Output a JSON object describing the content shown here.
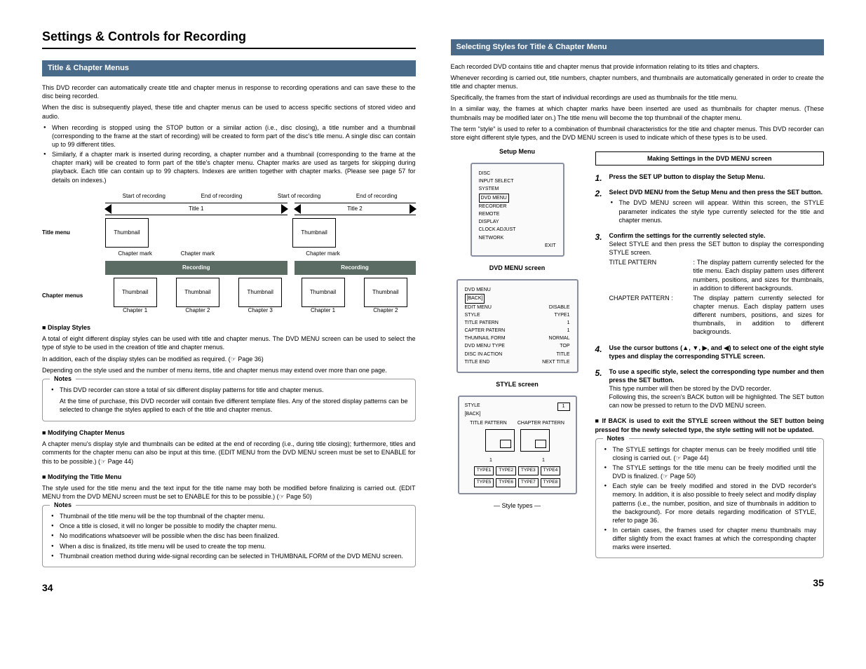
{
  "heading": "Settings & Controls for Recording",
  "left": {
    "section": "Title & Chapter Menus",
    "intro1": "This DVD recorder can automatically create title and chapter menus in response to recording operations and can save these to the disc being recorded.",
    "intro2": "When the disc is subsequently played, these title and chapter menus can be used to access specific sections of stored video and audio.",
    "b1": "When recording is stopped using the STOP button or a similar action (i.e., disc closing), a title number and a thumbnail (corresponding to the frame at the start of recording) will be created to form part of the disc's title menu. A single disc can contain up to 99 different titles.",
    "b2": "Similarly, if a chapter mark is inserted during recording, a chapter number and a thumbnail (corresponding to the frame at the chapter mark) will be created to form part of the title's chapter menu. Chapter marks are used as targets for skipping during playback. Each title can contain up to 99 chapters. Indexes are written together with chapter marks. (Please see page 57 for details on indexes.)",
    "diag": {
      "start_rec": "Start of recording",
      "end_rec": "End of recording",
      "title1": "Title 1",
      "title2": "Title 2",
      "title_menu": "Title menu",
      "thumbnail": "Thumbnail",
      "chapter_mark": "Chapter mark",
      "recording": "Recording",
      "chapter_menus": "Chapter menus",
      "ch1": "Chapter 1",
      "ch2": "Chapter 2",
      "ch3": "Chapter 3"
    },
    "disp_h": "Display Styles",
    "disp1": "A total of eight different display styles can be used with title and chapter menus. The DVD MENU screen can be used to select the type of style to be used in the creation of title and chapter menus.",
    "disp2": "In addition, each of the display styles can be modified as required. (☞ Page 36)",
    "disp3": "Depending on the style used and the number of menu items, title and chapter menus may extend over more than one page.",
    "notes1_label": "Notes",
    "n1a": "This DVD recorder can store a total of six different display patterns for title and chapter menus.",
    "n1b": "At the time of purchase, this DVD recorder will contain five different template files. Any of the stored display patterns can be selected to change the styles applied to each of the title and chapter menus.",
    "mod_ch_h": "Modifying Chapter Menus",
    "mod_ch": "A chapter menu's display style and thumbnails can be edited at the end of recording (i.e., during title closing); furthermore, titles and comments for the chapter menu can also be input at this time. (EDIT MENU from the DVD MENU screen must be set to ENABLE for this to be possible.) (☞ Page 44)",
    "mod_ti_h": "Modifying the Title Menu",
    "mod_ti": "The style used for the title menu and the text input for the title name may both be modified before finalizing is carried out. (EDIT MENU from the DVD MENU screen must be set to ENABLE for this to be possible.) (☞ Page 50)",
    "n2a": "Thumbnail of the title menu will be the top thumbnail of the chapter menu.",
    "n2b": "Once a title is closed, it will no longer be possible to modify the chapter menu.",
    "n2c": "No modifications whatsoever will be possible when the disc has been finalized.",
    "n2d": "When a disc is finalized, its title menu will be used to create the top menu.",
    "n2e": "Thumbnail creation method during wide-signal recording can be selected in THUMBNAIL FORM of the DVD MENU screen.",
    "page": "34"
  },
  "right": {
    "section": "Selecting Styles for Title & Chapter Menu",
    "p1": "Each recorded DVD contains title and chapter menus that provide information relating to its titles and chapters.",
    "p2": "Whenever recording is carried out, title numbers, chapter numbers, and thumbnails are automatically generated in order to create the title and chapter menus.",
    "p3": "Specifically, the frames from the start of individual recordings are used as thumbnails for the title menu.",
    "p4": "In a similar way, the frames at which chapter marks have been inserted are used as thumbnails for chapter menus. (These thumbnails may be modified later on.) The title menu will become the top thumbnail of the chapter menu.",
    "p5": "The term \"style\" is used to refer to a combination of thumbnail characteristics for the title and chapter menus. This DVD recorder can store eight different style types, and the DVD MENU screen is used to indicate which of these types is to be used.",
    "setup_caption": "Setup Menu",
    "setup_items": [
      "DISC",
      "INPUT SELECT",
      "SYSTEM",
      "DVD MENU",
      "RECORDER",
      "REMOTE",
      "DISPLAY",
      "CLOCK ADJUST",
      "NETWORK",
      "EXIT"
    ],
    "dvd_caption": "DVD MENU screen",
    "dvd_items": [
      {
        "l": "DVD MENU",
        "r": ""
      },
      {
        "l": "[BACK]",
        "r": ""
      },
      {
        "l": "EDIT MENU",
        "r": "DISABLE"
      },
      {
        "l": "STYLE",
        "r": "TYPE1"
      },
      {
        "l": "TITLE PATERN",
        "r": "1"
      },
      {
        "l": "CAPTER PATERN",
        "r": "1"
      },
      {
        "l": "THUMNAIL FORM",
        "r": "NORMAL"
      },
      {
        "l": "DVD MENU TYPE",
        "r": "TOP"
      },
      {
        "l": "DISC IN ACTION",
        "r": "TITLE"
      },
      {
        "l": "TITLE END",
        "r": "NEXT TITLE"
      }
    ],
    "style_caption": "STYLE screen",
    "style_box": {
      "header": "STYLE",
      "back": "[BACK]",
      "num": "1",
      "tp": "TITLE PATTERN",
      "cp": "CHAPTER PATTERN",
      "types": [
        "TYPE1",
        "TYPE2",
        "TYPE3",
        "TYPE4",
        "TYPE5",
        "TYPE6",
        "TYPE7",
        "TYPE8"
      ],
      "footer": "Style types"
    },
    "box_title": "Making Settings in the DVD MENU screen",
    "s1": "Press the SET UP button to display the Setup Menu.",
    "s2": "Select DVD MENU from the Setup Menu and then press the SET button.",
    "s2a": "The DVD MENU screen will appear. Within this screen, the STYLE parameter indicates the style type currently selected for the title and chapter menus.",
    "s3": "Confirm the settings for the currently selected style.",
    "s3a": "Select STYLE and then press the SET button to display the corresponding STYLE screen.",
    "s3_tp_l": "TITLE PATTERN",
    "s3_tp_r": ": The display pattern currently selected for the title menu. Each display pattern uses different numbers, positions, and sizes for thumbnails, in addition to different backgrounds.",
    "s3_cp_l": "CHAPTER PATTERN :",
    "s3_cp_r": "The display pattern currently selected for chapter menus. Each display pattern uses different numbers, positions, and sizes for thumbnails, in addition to different backgrounds.",
    "s4": "Use the cursor buttons (▲, ▼, ▶, and ◀) to select one of the eight style types and display the corresponding STYLE screen.",
    "s5": "To use a specific style, select the corresponding type number and then press the SET button.",
    "s5a": "This type number will then be stored by the DVD recorder.",
    "s5b": "Following this, the screen's BACK button will be highlighted. The SET button can now be pressed to return to the DVD MENU screen.",
    "back_note": "If BACK is used to exit the STYLE screen without the SET button being pressed for the newly selected type, the style setting will not be updated.",
    "rn1": "The STYLE settings for chapter menus can be freely modified until title closing is carried out. (☞ Page 44)",
    "rn2": "The STYLE settings for the title menu can be freely modified until the DVD is finalized. (☞ Page 50)",
    "rn3": "Each style can be freely modified and stored in the DVD recorder's memory. In addition, it is also possible to freely select and modify display patterns (i.e., the number, position, and size of thumbnails in addition to the background). For more details regarding modification of STYLE, refer to page 36.",
    "rn4": "In certain cases, the frames used for chapter menu thumbnails may differ slightly from the exact frames at which the corresponding chapter marks were inserted.",
    "page": "35"
  }
}
